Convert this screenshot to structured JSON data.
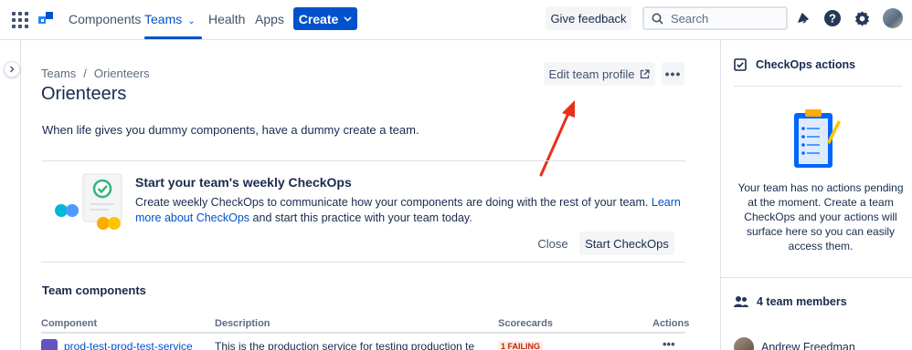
{
  "nav": {
    "items": [
      {
        "label": "Components",
        "active": false
      },
      {
        "label": "Teams",
        "active": true
      },
      {
        "label": "Health",
        "active": false
      },
      {
        "label": "Apps",
        "active": false
      }
    ],
    "create_label": "Create",
    "feedback_label": "Give feedback",
    "search_placeholder": "Search",
    "icons": [
      "apps-grid-icon",
      "compass-logo",
      "notification-icon",
      "help-icon",
      "settings-icon",
      "user-avatar"
    ]
  },
  "breadcrumb": {
    "root": "Teams",
    "separator": "/",
    "current": "Orienteers"
  },
  "page": {
    "title": "Orienteers",
    "edit_label": "Edit team profile",
    "more_label": "•••",
    "description": "When life gives you dummy components, have a dummy create a team."
  },
  "checkops_card": {
    "title": "Start your team's weekly CheckOps",
    "body_prefix": "Create weekly CheckOps to communicate how your components are doing with the rest of your team.",
    "link_text": "Learn more about CheckOps",
    "body_suffix": " and start this practice with your team today.",
    "close_label": "Close",
    "start_label": "Start CheckOps"
  },
  "team_components": {
    "title": "Team components",
    "columns": [
      "Component",
      "Description",
      "Scorecards",
      "Actions"
    ],
    "rows": [
      {
        "name": "prod-test-prod-test-service",
        "description": "This is the production service for testing production te",
        "badge": "1 FAILING",
        "actions": "•••"
      }
    ]
  },
  "right_panel": {
    "actions_title": "CheckOps actions",
    "empty_text": "Your team has no actions pending at the moment. Create a team CheckOps and your actions will surface here so you can easily access them.",
    "members_title": "4 team members",
    "members": [
      {
        "name": "Andrew Freedman"
      }
    ]
  },
  "colors": {
    "brand": "#0052cc",
    "text": "#172b4d",
    "annotation_arrow": "#e8301c",
    "failing_badge": "#bf2600"
  }
}
